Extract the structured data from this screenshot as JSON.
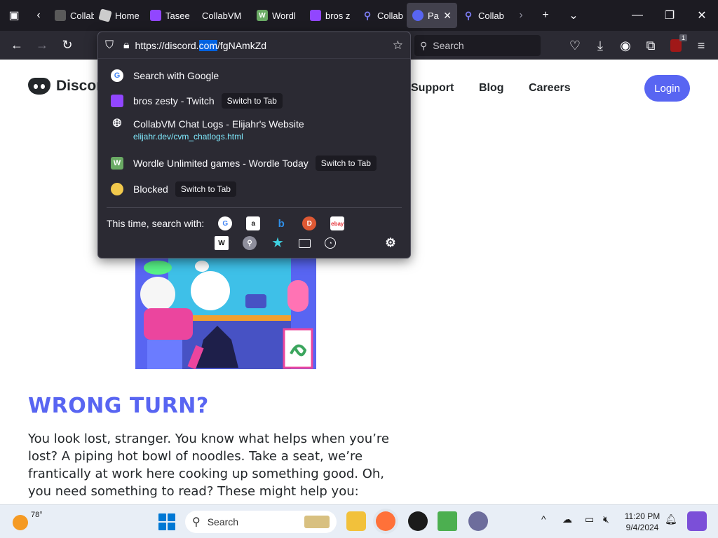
{
  "browser": {
    "tabs": [
      {
        "label": "Collab",
        "icon": "collabvm-icon",
        "color": "#5a5a5a"
      },
      {
        "label": "Home",
        "icon": "roblox-icon",
        "color": "#cccccc"
      },
      {
        "label": "Tasee",
        "icon": "twitch-icon",
        "color": "#9146ff"
      },
      {
        "label": "CollabVM",
        "icon": "none",
        "color": ""
      },
      {
        "label": "Wordl",
        "icon": "wordle-icon",
        "color": "#6aaa64"
      },
      {
        "label": "bros z",
        "icon": "twitch-icon",
        "color": "#9146ff"
      },
      {
        "label": "Collab",
        "icon": "search-icon",
        "color": "#5b5bd6"
      },
      {
        "label": "Pa",
        "icon": "discord-icon",
        "color": "#5865f2"
      },
      {
        "label": "Collab",
        "icon": "search-icon",
        "color": "#5b5bd6"
      }
    ],
    "url": {
      "pre": "https://discord.",
      "selected": "com",
      "post": "/fgNAmkZd"
    },
    "search_placeholder": "Search",
    "extension_badge": "1"
  },
  "dropdown": {
    "results": [
      {
        "title": "Search with Google",
        "icon": "google-search-icon"
      },
      {
        "title": "bros zesty - Twitch",
        "switch": "Switch to Tab",
        "icon": "twitch-icon"
      },
      {
        "title": "CollabVM Chat Logs - Elijahr's Website",
        "url": "elijahr.dev/cvm_chatlogs.html",
        "icon": "globe-icon"
      },
      {
        "title": "Wordle Unlimited games - Wordle Today",
        "switch": "Switch to Tab",
        "icon": "wordle-icon"
      },
      {
        "title": "Blocked",
        "switch": "Switch to Tab",
        "icon": "blocked-icon"
      }
    ],
    "search_with_label": "This time, search with:"
  },
  "page": {
    "logo_text": "Discord",
    "nav": [
      "Support",
      "Blog",
      "Careers"
    ],
    "login": "Login",
    "headline": "WRONG TURN?",
    "body": "You look lost, stranger. You know what helps when you’re lost? A piping hot bowl of noodles. Take a seat, we’re frantically at work here cooking up something good. Oh, you need something to read? These might help you:"
  },
  "taskbar": {
    "temperature": "78°",
    "search_placeholder": "Search",
    "time": "11:20 PM",
    "date": "9/4/2024"
  }
}
